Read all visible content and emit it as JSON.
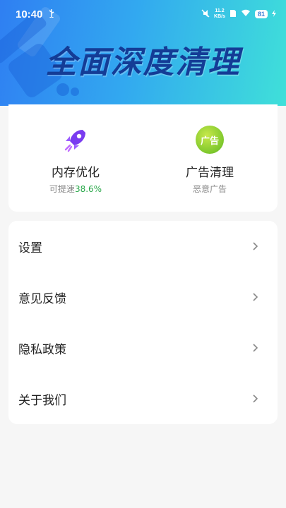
{
  "status_bar": {
    "time": "10:40",
    "net_speed_value": "11.2",
    "net_speed_unit": "KB/s",
    "battery": "81"
  },
  "hero": {
    "title": "全面深度清理"
  },
  "features": [
    {
      "title": "内存优化",
      "subtitle_prefix": "可提速",
      "subtitle_value": "38.6%",
      "icon": "rocket-icon"
    },
    {
      "title": "广告清理",
      "subtitle": "恶意广告",
      "icon_text": "广告",
      "icon": "ad-block-icon"
    }
  ],
  "menu": {
    "items": [
      {
        "label": "设置"
      },
      {
        "label": "意见反馈"
      },
      {
        "label": "隐私政策"
      },
      {
        "label": "关于我们"
      }
    ]
  },
  "colors": {
    "hero_gradient_start": "#2f7ff2",
    "hero_gradient_end": "#3fe0d9",
    "title_color": "#143c96",
    "accent_green": "#2aa84a"
  }
}
